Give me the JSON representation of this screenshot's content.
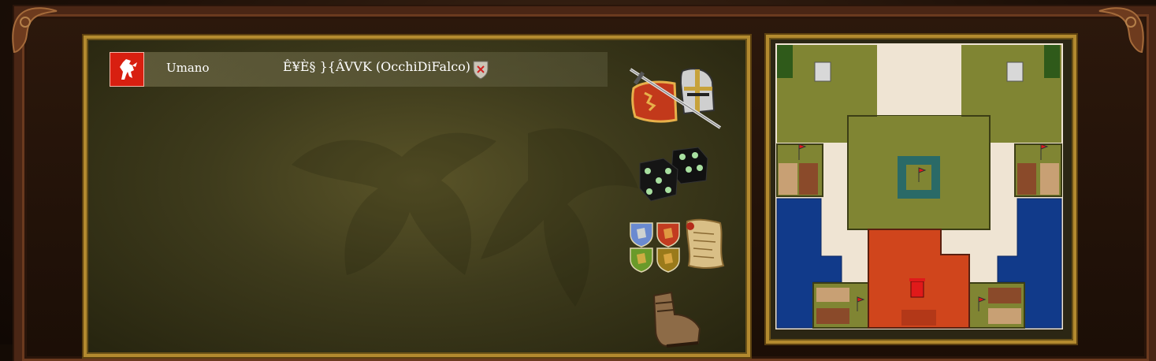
{
  "player": {
    "type": "Umano",
    "name": "Ê¥È§ }{ÂVVK (OcchiDiFalco)",
    "banner_color": "#d81f10"
  },
  "icons": {
    "battle": "crossed-sword-helmet-icon",
    "dice": "dice-icon",
    "teams": "team-shields-icon",
    "scroll": "scroll-icon",
    "boot": "boot-icon"
  },
  "map": {
    "player_color": "#d0451c",
    "colors": [
      "#808533",
      "#113a8a",
      "#efe4d3",
      "#2a6a67"
    ]
  }
}
